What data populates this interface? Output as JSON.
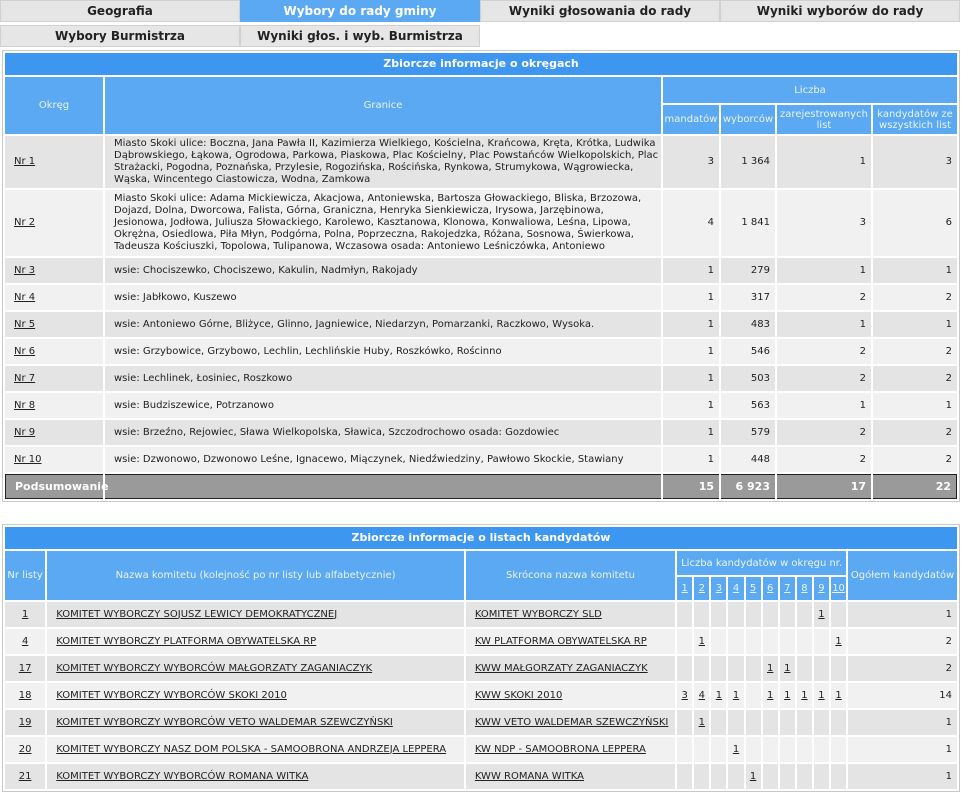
{
  "tabs": {
    "row1": [
      "Geografia",
      "Wybory do rady gminy",
      "Wyniki głosowania do rady",
      "Wyniki wyborów do rady"
    ],
    "row2": [
      "Wybory Burmistrza",
      "Wyniki głos. i wyb. Burmistrza"
    ]
  },
  "districts": {
    "caption": "Zbiorcze informacje o okręgach",
    "headers": {
      "okreg": "Okręg",
      "granice": "Granice",
      "liczba": "Liczba",
      "mandatow": "mandatów",
      "wyborcow": "wyborców",
      "listy": "zarejestrowanych list",
      "kandydaci": "kandydatów ze wszystkich list"
    },
    "rows": [
      {
        "nr": "Nr 1",
        "granice": "Miasto Skoki ulice: Boczna, Jana Pawła II, Kazimierza Wielkiego, Kościelna, Krańcowa, Kręta, Krótka, Ludwika Dąbrowskiego, Łąkowa, Ogrodowa, Parkowa, Piaskowa, Plac Kościelny, Plac Powstańców Wielkopolskich, Plac Strażacki, Pogodna, Poznańska, Przylesie, Rogozińska, Rościńska, Rynkowa, Strumykowa, Wągrowiecka, Wąska, Wincentego Ciastowicza, Wodna, Zamkowa",
        "mandatow": "3",
        "wyborcow": "1 364",
        "listy": "1",
        "kandydaci": "3"
      },
      {
        "nr": "Nr 2",
        "granice": "Miasto Skoki ulice: Adama Mickiewicza, Akacjowa, Antoniewska, Bartosza Głowackiego, Bliska, Brzozowa, Dojazd, Dolna, Dworcowa, Falista, Górna, Graniczna, Henryka Sienkiewicza, Irysowa, Jarzębinowa, Jesionowa, Jodłowa, Juliusza Słowackiego, Karolewo, Kasztanowa, Klonowa, Konwaliowa, Leśna, Lipowa, Okrężna, Osiedlowa, Piła Młyn, Podgórna, Polna, Poprzeczna, Rakojedzka, Różana, Sosnowa, Świerkowa, Tadeusza Kościuszki, Topolowa, Tulipanowa, Wczasowa osada: Antoniewo Leśniczówka, Antoniewo",
        "mandatow": "4",
        "wyborcow": "1 841",
        "listy": "3",
        "kandydaci": "6"
      },
      {
        "nr": "Nr 3",
        "granice": "wsie: Chociszewko, Chociszewo, Kakulin, Nadmłyn, Rakojady",
        "mandatow": "1",
        "wyborcow": "279",
        "listy": "1",
        "kandydaci": "1"
      },
      {
        "nr": "Nr 4",
        "granice": "wsie: Jabłkowo, Kuszewo",
        "mandatow": "1",
        "wyborcow": "317",
        "listy": "2",
        "kandydaci": "2"
      },
      {
        "nr": "Nr 5",
        "granice": "wsie: Antoniewo Górne, Bliżyce, Glinno, Jagniewice, Niedarzyn, Pomarzanki, Raczkowo, Wysoka.",
        "mandatow": "1",
        "wyborcow": "483",
        "listy": "1",
        "kandydaci": "1"
      },
      {
        "nr": "Nr 6",
        "granice": "wsie: Grzybowice, Grzybowo, Lechlin, Lechlińskie Huby, Roszkówko, Rościnno",
        "mandatow": "1",
        "wyborcow": "546",
        "listy": "2",
        "kandydaci": "2"
      },
      {
        "nr": "Nr 7",
        "granice": "wsie: Lechlinek, Łosiniec, Roszkowo",
        "mandatow": "1",
        "wyborcow": "503",
        "listy": "2",
        "kandydaci": "2"
      },
      {
        "nr": "Nr 8",
        "granice": "wsie: Budziszewice, Potrzanowo",
        "mandatow": "1",
        "wyborcow": "563",
        "listy": "1",
        "kandydaci": "1"
      },
      {
        "nr": "Nr 9",
        "granice": "wsie: Brzeźno, Rejowiec, Sława Wielkopolska, Sławica, Szczodrochowo osada: Gozdowiec",
        "mandatow": "1",
        "wyborcow": "579",
        "listy": "2",
        "kandydaci": "2"
      },
      {
        "nr": "Nr 10",
        "granice": "wsie: Dzwonowo, Dzwonowo Leśne, Ignacewo, Miączynek, Niedźwiedziny, Pawłowo Skockie, Stawiany",
        "mandatow": "1",
        "wyborcow": "448",
        "listy": "2",
        "kandydaci": "2"
      }
    ],
    "summary": {
      "label": "Podsumowanie",
      "mandatow": "15",
      "wyborcow": "6 923",
      "listy": "17",
      "kandydaci": "22"
    }
  },
  "lists": {
    "caption": "Zbiorcze informacje o listach kandydatów",
    "headers": {
      "nr": "Nr listy",
      "nazwa": "Nazwa komitetu (kolejność po nr listy lub alfabetycznie)",
      "skrot": "Skrócona nazwa komitetu",
      "liczba": "Liczba kandydatów w okręgu nr.",
      "okregi": [
        "1",
        "2",
        "3",
        "4",
        "5",
        "6",
        "7",
        "8",
        "9",
        "10"
      ],
      "ogolem": "Ogółem kandydatów"
    },
    "rows": [
      {
        "nr": "1",
        "nazwa": "KOMITET WYBORCZY SOJUSZ LEWICY DEMOKRATYCZNEJ",
        "skrot": "KOMITET WYBORCZY SLD",
        "counts": [
          "",
          "",
          "",
          "",
          "",
          "",
          "",
          "",
          "1",
          ""
        ],
        "ogolem": "1"
      },
      {
        "nr": "4",
        "nazwa": "KOMITET WYBORCZY PLATFORMA OBYWATELSKA RP",
        "skrot": "KW PLATFORMA OBYWATELSKA RP",
        "counts": [
          "",
          "1",
          "",
          "",
          "",
          "",
          "",
          "",
          "",
          "1"
        ],
        "ogolem": "2"
      },
      {
        "nr": "17",
        "nazwa": "KOMITET WYBORCZY WYBORCÓW MAŁGORZATY ZAGANIACZYK",
        "skrot": "KWW MAŁGORZATY ZAGANIACZYK",
        "counts": [
          "",
          "",
          "",
          "",
          "",
          "1",
          "1",
          "",
          "",
          ""
        ],
        "ogolem": "2"
      },
      {
        "nr": "18",
        "nazwa": "KOMITET WYBORCZY WYBORCÓW SKOKI 2010",
        "skrot": "KWW SKOKI 2010",
        "counts": [
          "3",
          "4",
          "1",
          "1",
          "",
          "1",
          "1",
          "1",
          "1",
          "1"
        ],
        "ogolem": "14"
      },
      {
        "nr": "19",
        "nazwa": "KOMITET WYBORCZY WYBORCÓW VETO WALDEMAR SZEWCZYŃSKI",
        "skrot": "KWW VETO WALDEMAR SZEWCZYŃSKI",
        "counts": [
          "",
          "1",
          "",
          "",
          "",
          "",
          "",
          "",
          "",
          ""
        ],
        "ogolem": "1"
      },
      {
        "nr": "20",
        "nazwa": "KOMITET WYBORCZY NASZ DOM POLSKA - SAMOOBRONA ANDRZEJA LEPPERA",
        "skrot": "KW NDP - SAMOOBRONA LEPPERA",
        "counts": [
          "",
          "",
          "",
          "1",
          "",
          "",
          "",
          "",
          "",
          ""
        ],
        "ogolem": "1"
      },
      {
        "nr": "21",
        "nazwa": "KOMITET WYBORCZY WYBORCÓW ROMANA WITKA",
        "skrot": "KWW ROMANA WITKA",
        "counts": [
          "",
          "",
          "",
          "",
          "1",
          "",
          "",
          "",
          "",
          ""
        ],
        "ogolem": "1"
      }
    ]
  }
}
